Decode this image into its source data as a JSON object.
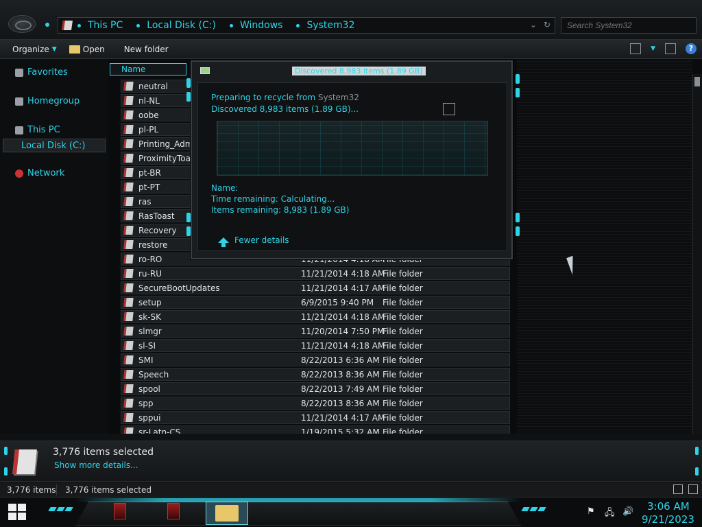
{
  "address": {
    "crumbs": [
      "This PC",
      "Local Disk (C:)",
      "Windows",
      "System32"
    ],
    "search_placeholder": "Search System32"
  },
  "toolbar": {
    "organize": "Organize",
    "open": "Open",
    "new_folder": "New folder"
  },
  "nav": {
    "favorites": "Favorites",
    "homegroup": "Homegroup",
    "this_pc": "This PC",
    "local_disk": "Local Disk (C:)",
    "network": "Network"
  },
  "filelist": {
    "column_name": "Name",
    "rows": [
      {
        "name": "neutral",
        "date": "",
        "type": ""
      },
      {
        "name": "nl-NL",
        "date": "",
        "type": ""
      },
      {
        "name": "oobe",
        "date": "",
        "type": ""
      },
      {
        "name": "pl-PL",
        "date": "",
        "type": ""
      },
      {
        "name": "Printing_Admin",
        "date": "",
        "type": ""
      },
      {
        "name": "ProximityToast",
        "date": "",
        "type": ""
      },
      {
        "name": "pt-BR",
        "date": "",
        "type": ""
      },
      {
        "name": "pt-PT",
        "date": "",
        "type": ""
      },
      {
        "name": "ras",
        "date": "",
        "type": ""
      },
      {
        "name": "RasToast",
        "date": "",
        "type": ""
      },
      {
        "name": "Recovery",
        "date": "",
        "type": ""
      },
      {
        "name": "restore",
        "date": "",
        "type": ""
      },
      {
        "name": "ro-RO",
        "date": "11/21/2014 4:18 AM",
        "type": "File folder"
      },
      {
        "name": "ru-RU",
        "date": "11/21/2014 4:18 AM",
        "type": "File folder"
      },
      {
        "name": "SecureBootUpdates",
        "date": "11/21/2014 4:17 AM",
        "type": "File folder"
      },
      {
        "name": "setup",
        "date": "6/9/2015 9:40 PM",
        "type": "File folder"
      },
      {
        "name": "sk-SK",
        "date": "11/21/2014 4:18 AM",
        "type": "File folder"
      },
      {
        "name": "slmgr",
        "date": "11/20/2014 7:50 PM",
        "type": "File folder"
      },
      {
        "name": "sl-SI",
        "date": "11/21/2014 4:18 AM",
        "type": "File folder"
      },
      {
        "name": "SMI",
        "date": "8/22/2013 6:36 AM",
        "type": "File folder"
      },
      {
        "name": "Speech",
        "date": "8/22/2013 8:36 AM",
        "type": "File folder"
      },
      {
        "name": "spool",
        "date": "8/22/2013 7:49 AM",
        "type": "File folder"
      },
      {
        "name": "spp",
        "date": "8/22/2013 8:36 AM",
        "type": "File folder"
      },
      {
        "name": "sppui",
        "date": "11/21/2014 4:17 AM",
        "type": "File folder"
      },
      {
        "name": "sr-Latn-CS",
        "date": "1/19/2015 5:32 AM",
        "type": "File folder"
      }
    ]
  },
  "dialog": {
    "title": "Discovered 8,983 items (1.89 GB)",
    "preparing_label": "Preparing to recycle from",
    "preparing_source": "System32",
    "discovered": "Discovered 8,983 items (1.89 GB)...",
    "name_label": "Name:",
    "time_remaining": "Time remaining:  Calculating...",
    "items_remaining": "Items remaining:  8,983 (1.89 GB)",
    "fewer_details": "Fewer details"
  },
  "details": {
    "count": "3,776 items selected",
    "link": "Show more details..."
  },
  "status": {
    "items": "3,776 items",
    "selected": "3,776 items selected"
  },
  "clock": {
    "time": "3:06 AM",
    "date": "9/21/2023"
  },
  "colors": {
    "accent": "#2fd3e8",
    "background": "#0a0b0c"
  }
}
